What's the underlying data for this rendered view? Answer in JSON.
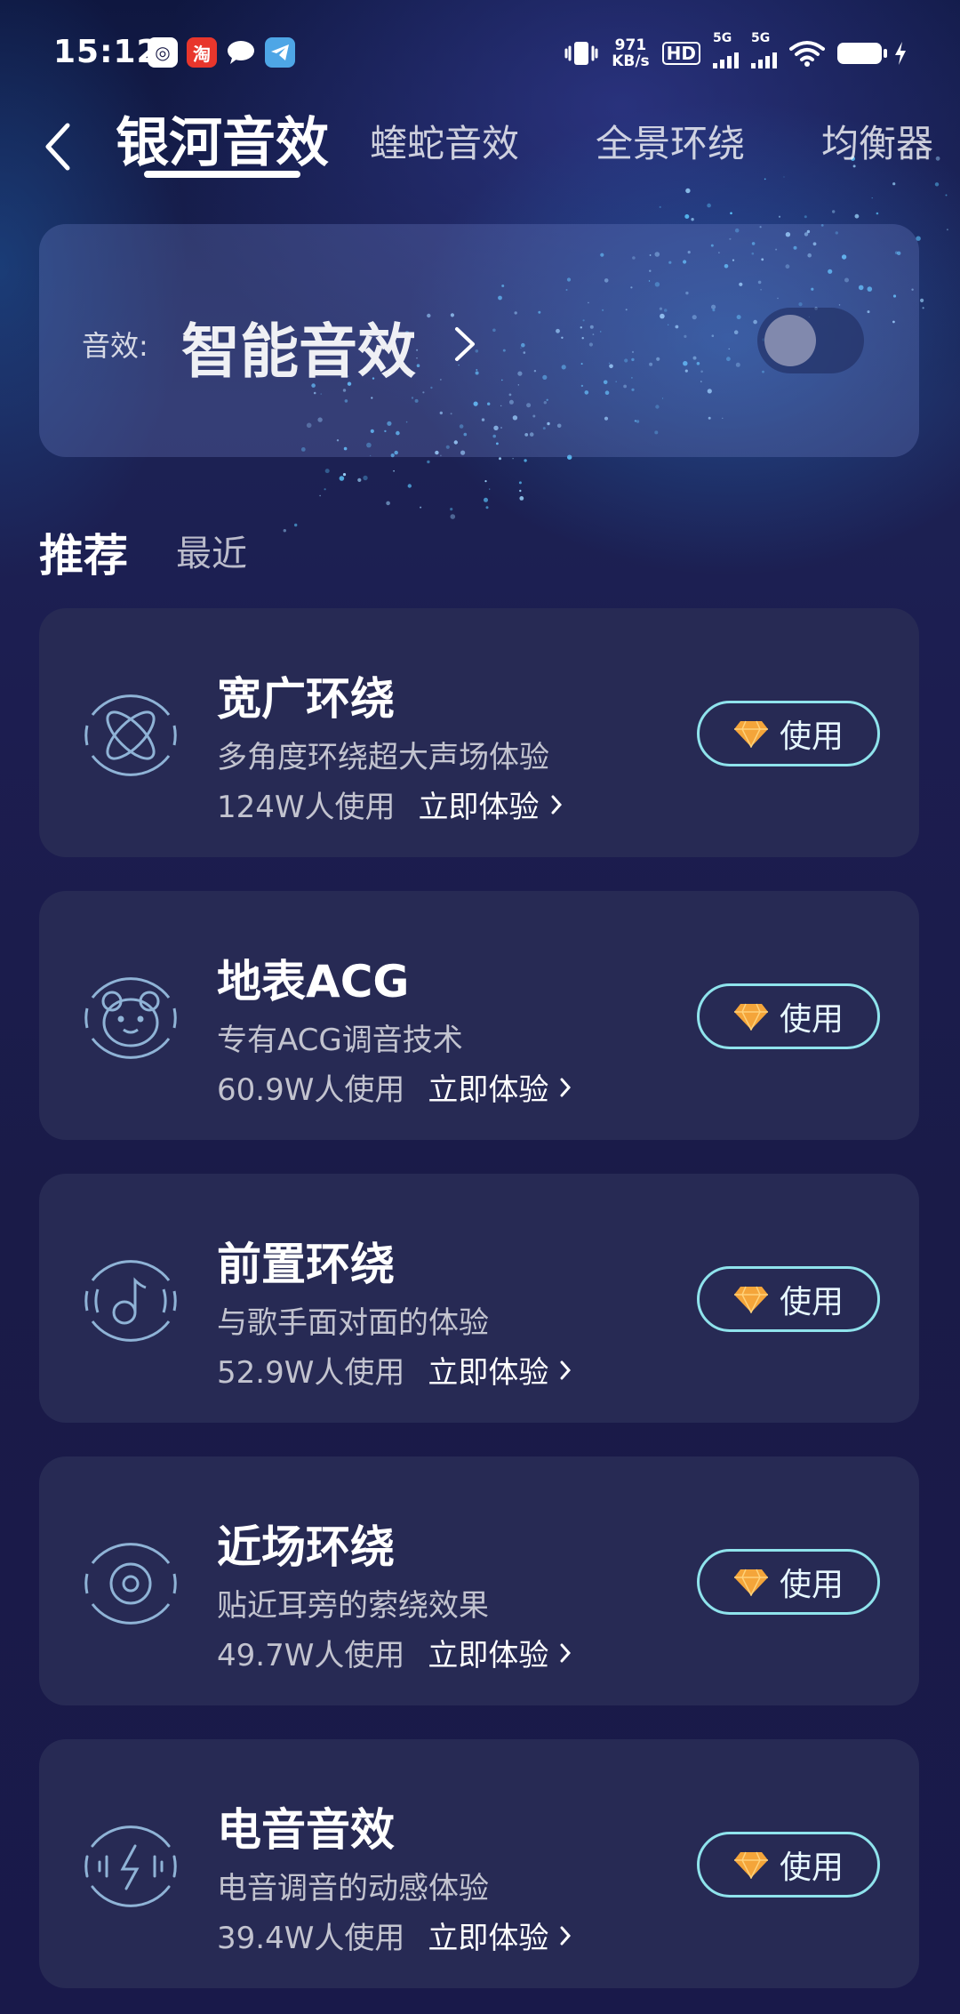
{
  "status_bar": {
    "time": "15:12",
    "network_speed_value": "971",
    "network_speed_unit": "KB/s",
    "hd_label": "HD",
    "signal_1_label": "5G",
    "signal_2_label": "5G",
    "notification_icons": [
      "app-icon",
      "taobao-icon",
      "chat-icon",
      "telegram-icon"
    ]
  },
  "header": {
    "tabs": [
      {
        "label": "银河音效",
        "active": true
      },
      {
        "label": "蝰蛇音效",
        "active": false
      },
      {
        "label": "全景环绕",
        "active": false
      },
      {
        "label": "均衡器",
        "active": false
      }
    ]
  },
  "mode_card": {
    "label": "音效:",
    "value": "智能音效",
    "toggle_on": false
  },
  "section_tabs": [
    {
      "label": "推荐",
      "active": true
    },
    {
      "label": "最近",
      "active": false
    }
  ],
  "effects": [
    {
      "name": "宽广环绕",
      "desc": "多角度环绕超大声场体验",
      "usage": "124W人使用",
      "try_label": "立即体验",
      "button_label": "使用",
      "icon": "atom-icon"
    },
    {
      "name": "地表ACG",
      "desc": "专有ACG调音技术",
      "usage": "60.9W人使用",
      "try_label": "立即体验",
      "button_label": "使用",
      "icon": "bear-icon"
    },
    {
      "name": "前置环绕",
      "desc": "与歌手面对面的体验",
      "usage": "52.9W人使用",
      "try_label": "立即体验",
      "button_label": "使用",
      "icon": "music-note-icon"
    },
    {
      "name": "近场环绕",
      "desc": "贴近耳旁的萦绕效果",
      "usage": "49.7W人使用",
      "try_label": "立即体验",
      "button_label": "使用",
      "icon": "speaker-icon"
    },
    {
      "name": "电音音效",
      "desc": "电音调音的动感体验",
      "usage": "39.4W人使用",
      "try_label": "立即体验",
      "button_label": "使用",
      "icon": "lightning-icon"
    }
  ],
  "colors": {
    "background": "#1a1b48",
    "card": "#272a54",
    "button_border": "#8fe3ec",
    "diamond": "#f4a53a",
    "icon_stroke": "#8fb3d6"
  }
}
